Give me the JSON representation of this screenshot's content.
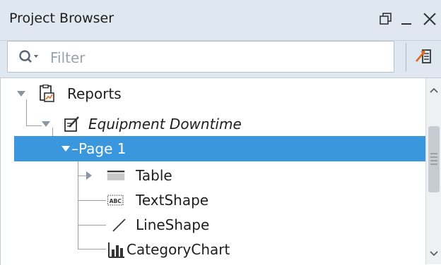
{
  "panel": {
    "title": "Project Browser"
  },
  "filter": {
    "placeholder": "Filter",
    "value": ""
  },
  "tree": {
    "reports": {
      "label": "Reports"
    },
    "report": {
      "label": "Equipment Downtime"
    },
    "page": {
      "label": "Page 1"
    },
    "items": [
      {
        "label": "Table"
      },
      {
        "label": "TextShape"
      },
      {
        "label": "LineShape"
      },
      {
        "label": "CategoryChart"
      }
    ]
  },
  "colors": {
    "selection": "#3a96dd",
    "header_bg": "#dfe8f1"
  }
}
